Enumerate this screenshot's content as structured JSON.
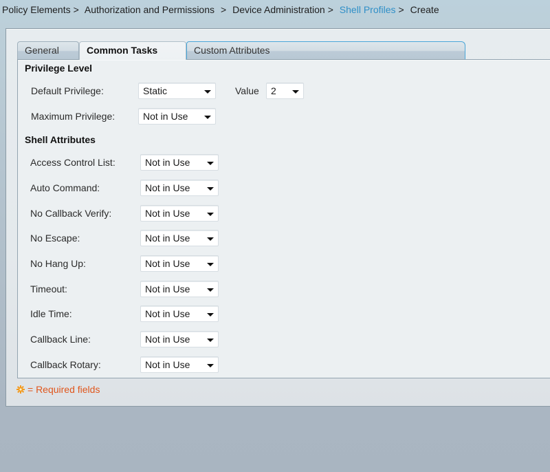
{
  "breadcrumb": {
    "items": [
      {
        "label": "Policy Elements",
        "link": false
      },
      {
        "label": "Authorization and Permissions",
        "link": false
      },
      {
        "label": "Device Administration",
        "link": false
      },
      {
        "label": "Shell Profiles",
        "link": true
      },
      {
        "label": "Create",
        "link": false
      }
    ],
    "separator": ">"
  },
  "tabs": [
    {
      "label": "General",
      "active": false
    },
    {
      "label": "Common Tasks",
      "active": true
    },
    {
      "label": "Custom Attributes",
      "active": false
    }
  ],
  "privilege_level": {
    "title": "Privilege Level",
    "default_privilege": {
      "label": "Default Privilege:",
      "value": "Static"
    },
    "value_field": {
      "label": "Value",
      "value": "2"
    },
    "maximum_privilege": {
      "label": "Maximum Privilege:",
      "value": "Not in Use"
    }
  },
  "shell_attributes": {
    "title": "Shell Attributes",
    "fields": [
      {
        "label": "Access Control List:",
        "value": "Not in Use"
      },
      {
        "label": "Auto Command:",
        "value": "Not in Use"
      },
      {
        "label": "No Callback Verify:",
        "value": "Not in Use"
      },
      {
        "label": "No Escape:",
        "value": "Not in Use"
      },
      {
        "label": "No Hang Up:",
        "value": "Not in Use"
      },
      {
        "label": "Timeout:",
        "value": "Not in Use"
      },
      {
        "label": "Idle Time:",
        "value": "Not in Use"
      },
      {
        "label": "Callback Line:",
        "value": "Not in Use"
      },
      {
        "label": "Callback Rotary:",
        "value": "Not in Use"
      }
    ]
  },
  "footer": {
    "required_icon": "gear-icon",
    "required_text": "= Required fields"
  },
  "colors": {
    "link": "#2f8fc7",
    "required": "#e0561c",
    "active_tab_border": "#4aa6d8"
  }
}
